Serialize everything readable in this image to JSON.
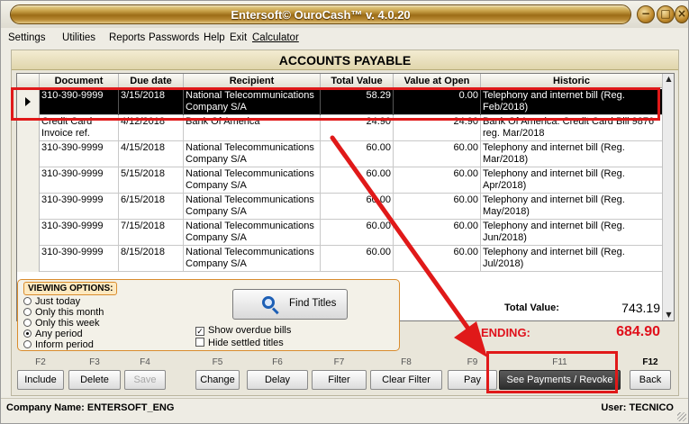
{
  "window": {
    "title": "Entersoft© OuroCash™ v. 4.0.20",
    "buttons": [
      "minimize",
      "maximize",
      "close"
    ]
  },
  "menu": [
    "Settings",
    "Utilities",
    "Reports",
    "Passwords",
    "Help",
    "Exit",
    "Calculator"
  ],
  "header": {
    "title": "ACCOUNTS PAYABLE"
  },
  "grid": {
    "columns": [
      "Document",
      "Due date",
      "Recipient",
      "Total Value",
      "Value at Open",
      "Historic"
    ],
    "rows": [
      {
        "document": "310-390-9999",
        "due": "3/15/2018",
        "recipient": "National Telecommunications Company S/A",
        "total": "58.29",
        "open": "0.00",
        "historic": "Telephony and internet bill (Reg. Feb/2018)",
        "selected": true
      },
      {
        "document": "Credit Card Invoice ref.",
        "due": "4/12/2018",
        "recipient": "Bank Of America",
        "total": "24.90",
        "open": "24.90",
        "historic": "Bank Of America: Credit Card Bill 9876 reg. Mar/2018",
        "selected": false
      },
      {
        "document": "310-390-9999",
        "due": "4/15/2018",
        "recipient": "National Telecommunications Company S/A",
        "total": "60.00",
        "open": "60.00",
        "historic": "Telephony and internet bill (Reg. Mar/2018)",
        "selected": false
      },
      {
        "document": "310-390-9999",
        "due": "5/15/2018",
        "recipient": "National Telecommunications Company S/A",
        "total": "60.00",
        "open": "60.00",
        "historic": "Telephony and internet bill (Reg. Apr/2018)",
        "selected": false
      },
      {
        "document": "310-390-9999",
        "due": "6/15/2018",
        "recipient": "National Telecommunications Company S/A",
        "total": "60.00",
        "open": "60.00",
        "historic": "Telephony and internet bill (Reg. May/2018)",
        "selected": false
      },
      {
        "document": "310-390-9999",
        "due": "7/15/2018",
        "recipient": "National Telecommunications Company S/A",
        "total": "60.00",
        "open": "60.00",
        "historic": "Telephony and internet bill (Reg. Jun/2018)",
        "selected": false
      },
      {
        "document": "310-390-9999",
        "due": "8/15/2018",
        "recipient": "National Telecommunications Company S/A",
        "total": "60.00",
        "open": "60.00",
        "historic": "Telephony and internet bill (Reg. Jul/2018)",
        "selected": false
      }
    ]
  },
  "viewing": {
    "label": "VIEWING OPTIONS:",
    "options": [
      "Just today",
      "Only this month",
      "Only this week",
      "Any period",
      "Inform period"
    ],
    "selected_index": 3,
    "find_label": "Find Titles",
    "checks": [
      {
        "label": "Show overdue bills",
        "checked": true
      },
      {
        "label": "Hide settled titles",
        "checked": false
      }
    ]
  },
  "totals": {
    "total_label": "Total Value:",
    "total_value": "743.19",
    "pending_label": "ENDING:",
    "pending_value": "684.90"
  },
  "fkeys": [
    {
      "key": "F2",
      "label": "Include"
    },
    {
      "key": "F3",
      "label": "Delete"
    },
    {
      "key": "F4",
      "label": "Save"
    },
    {
      "key": "F5",
      "label": "Change"
    },
    {
      "key": "F6",
      "label": "Delay"
    },
    {
      "key": "F7",
      "label": "Filter"
    },
    {
      "key": "F8",
      "label": "Clear Filter"
    },
    {
      "key": "F9",
      "label": "Pay"
    },
    {
      "key": "F11",
      "label": "See Payments / Revoke"
    },
    {
      "key": "F12",
      "label": "Back"
    }
  ],
  "status": {
    "company": "Company Name: ENTERSOFT_ENG",
    "user": "User: TECNICO"
  },
  "colors": {
    "accent_red": "#e01919",
    "pending_red": "#e0101b",
    "title_gold": "#9c6c16"
  }
}
